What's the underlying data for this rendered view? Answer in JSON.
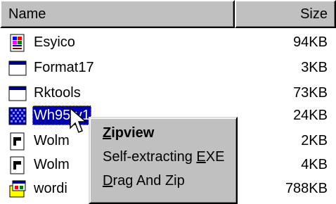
{
  "header": {
    "name_label": "Name",
    "size_label": "Size"
  },
  "files": [
    {
      "name": "Esyico",
      "size": "94KB",
      "icon": "file-icon",
      "selected": false
    },
    {
      "name": "Format17",
      "size": "3KB",
      "icon": "window-app-icon",
      "selected": false
    },
    {
      "name": "Rktools",
      "size": "73KB",
      "icon": "window-app-icon",
      "selected": false
    },
    {
      "name": "Wh95-v1",
      "size": "24KB",
      "icon": "archive-icon",
      "selected": true
    },
    {
      "name": "Wolm",
      "size": "2KB",
      "icon": "document-icon",
      "selected": false
    },
    {
      "name": "Wolm",
      "size": "4KB",
      "icon": "document-icon",
      "selected": false
    },
    {
      "name": "wordi",
      "size": "788KB",
      "icon": "setup-icon",
      "selected": false
    }
  ],
  "context_menu": {
    "items": [
      {
        "pre": "",
        "accel": "Z",
        "post": "ipview",
        "default": true
      },
      {
        "pre": "Self-extracting ",
        "accel": "E",
        "post": "XE",
        "default": false
      },
      {
        "pre": "",
        "accel": "D",
        "post": "rag And Zip",
        "default": false
      }
    ]
  },
  "colors": {
    "selection": "#0000a8",
    "face": "#c0c0c0"
  }
}
